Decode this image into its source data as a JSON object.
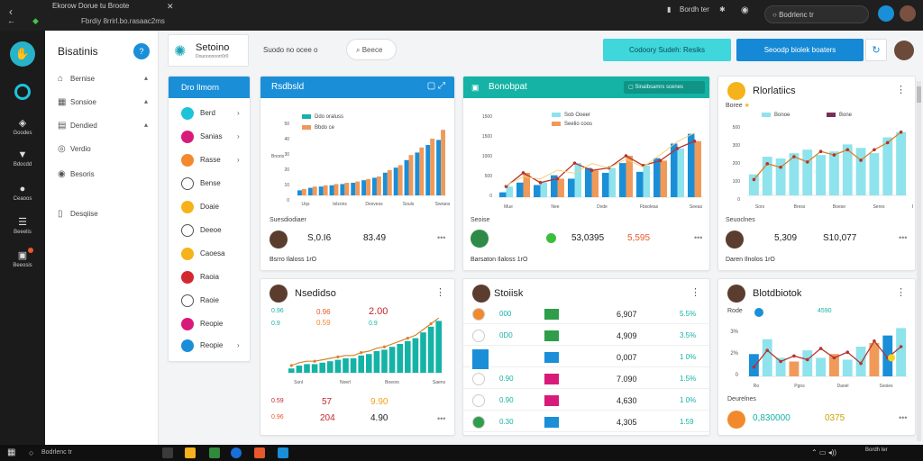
{
  "browser": {
    "tab_title": "Ekorow Dorue tu Broote",
    "url": "Fbrdiy 8rrirl.bo.rasaac2ms",
    "right_status": "Bordh ter",
    "search_text": "Bodrlenc tr"
  },
  "rail": {
    "items": [
      {
        "label": "Goodes"
      },
      {
        "label": "Bdocdd"
      },
      {
        "label": "Ceaoos"
      },
      {
        "label": "Beeelis"
      },
      {
        "label": "Beeosis"
      }
    ]
  },
  "sidebar": {
    "title": "Bisatinis",
    "items": [
      {
        "label": "Bernise",
        "icon": "home-icon"
      },
      {
        "label": "Sonsioe",
        "icon": "grid-icon"
      },
      {
        "label": "Dendied",
        "icon": "calendar-icon"
      },
      {
        "label": "Verdio",
        "icon": "clock-icon"
      },
      {
        "label": "Besoris",
        "icon": "globe-icon"
      },
      {
        "label": "Desqiise",
        "icon": "doc-icon"
      }
    ]
  },
  "header": {
    "logo_title": "Setoino",
    "logo_subtitle": "Dounoonoorr0r0",
    "select_label": "Suodo no ocee o",
    "search_label": "Beece",
    "btn_primary": "Codoory Sudeh: Resiks",
    "btn_secondary": "Seoodp biolek boaters"
  },
  "categories": {
    "title": "Dro Ilmorn",
    "items": [
      {
        "label": "Berd",
        "color": "#1ec3d9",
        "arrow": true
      },
      {
        "label": "Sanias",
        "color": "#d81b7a",
        "arrow": true
      },
      {
        "label": "Rasse",
        "color": "#f28a2d",
        "arrow": true
      },
      {
        "label": "Bense",
        "color": "#ffffff",
        "arrow": false
      },
      {
        "label": "Doaie",
        "color": "#f6b21b",
        "arrow": false
      },
      {
        "label": "Deeoe",
        "color": "#f6b21b",
        "arrow": false
      },
      {
        "label": "Caoesa",
        "color": "#d2282f",
        "arrow": false
      },
      {
        "label": "Raoia",
        "color": "#ffffff",
        "arrow": false
      },
      {
        "label": "Raoie",
        "color": "#d81b7a",
        "arrow": false
      },
      {
        "label": "Reopie",
        "color": "#1a8fd8",
        "arrow": true
      }
    ]
  },
  "card1": {
    "title": "Rsdbsld",
    "legend": [
      "Ddo oraluss",
      "Bbdo ce"
    ],
    "y_axis_label": "Bnoris",
    "foot_label": "Suesdiodiaer",
    "value_a": "S,0.I6",
    "value_b": "83.49",
    "note": "Bsrro Ilaloss  1rO"
  },
  "card2": {
    "title": "Bonobpat",
    "chip": "Sinaibsamrs scenes",
    "legend": [
      "Sob Ooeer",
      "Seelio coos"
    ],
    "foot_label": "Seoise",
    "value_a": "53,0395",
    "value_b": "5,595",
    "note": "Barsaton Ilaloss  1rO"
  },
  "card3": {
    "title": "Rlorlatiics",
    "legend": [
      "Boree",
      "Bonoe",
      "Bone"
    ],
    "foot_label": "Seuoclnes",
    "value_a": "5,309",
    "value_b": "S10,077",
    "note": "Daren Ilnolos  1rO"
  },
  "card4": {
    "title": "Nsedidso",
    "rows": [
      {
        "a": "0.96",
        "b": "2.00"
      },
      {
        "a": "0.9",
        "b": "0.59"
      }
    ],
    "foot": [
      {
        "a": "57",
        "b": "9.90"
      },
      {
        "a": "204",
        "b": "4.90"
      }
    ]
  },
  "card5": {
    "title": "Stoiisk",
    "rows": [
      {
        "name": "000",
        "value": "6,907",
        "pct": "5.5%"
      },
      {
        "name": "0D0",
        "value": "4,909",
        "pct": "3.5%"
      },
      {
        "name": "",
        "value": "0,007",
        "pct": "1 0%"
      },
      {
        "name": "0.90",
        "value": "7.090",
        "pct": "1.5%"
      },
      {
        "name": "0.90",
        "value": "4,630",
        "pct": "1 0%"
      },
      {
        "name": "0.30",
        "value": "4,305",
        "pct": "1.59"
      }
    ]
  },
  "card6": {
    "title": "Blotdbiotok",
    "legend": [
      "Rode",
      "4590"
    ],
    "foot_label": "Deurelnes",
    "value_a": "0,830000",
    "value_b": "0375"
  },
  "colors": {
    "blue": "#1a8fd8",
    "teal": "#14b3a6",
    "cyan": "#8ee3ec",
    "orange": "#f09a5a",
    "line_red": "#b5332d",
    "line_orange": "#d9822b"
  },
  "chart_data": [
    {
      "type": "bar",
      "title": "Rsdbsld",
      "categories": [
        "Uqs",
        "Ielzons",
        "Desvess",
        "Souls",
        "Swraos"
      ],
      "series": [
        {
          "name": "Ddo oraluss",
          "values": [
            4,
            6,
            7,
            8,
            9,
            10,
            12,
            14,
            18,
            22,
            28,
            34,
            40,
            44
          ]
        },
        {
          "name": "Bbdo ce",
          "values": [
            5,
            7,
            8,
            9,
            10,
            11,
            13,
            15,
            20,
            24,
            32,
            38,
            45,
            52
          ]
        }
      ],
      "y_ticks": [
        "50",
        "40",
        "30",
        "20",
        "10",
        "0"
      ]
    },
    {
      "type": "bar",
      "title": "Bonobpat",
      "categories": [
        "Mue",
        "Nee",
        "Dvde",
        "Fbsoleas",
        "Seeas"
      ],
      "y_ticks": [
        "1500",
        "1500",
        "1000",
        "500",
        "0"
      ],
      "series": [
        {
          "name": "Sob Ooeer",
          "values": [
            100,
            300,
            250,
            450,
            380,
            600,
            500,
            700,
            520,
            800,
            1100,
            1300
          ]
        },
        {
          "name": "Seelio coos",
          "values": [
            220,
            500,
            300,
            380,
            700,
            550,
            600,
            850,
            650,
            750,
            1000,
            1150
          ]
        }
      ]
    },
    {
      "type": "bar",
      "title": "Rlorlatiics",
      "categories": [
        "Sors",
        "Bress",
        "Boese",
        "Seres",
        "Bocos"
      ],
      "y_ticks": [
        "500",
        "300",
        "200",
        "100",
        "0"
      ],
      "series": [
        {
          "name": "Boree",
          "values": [
            120,
            220,
            210,
            240,
            260,
            230,
            250,
            290,
            270,
            240,
            330,
            360
          ]
        },
        {
          "name": "Bone",
          "values": [
            90,
            180,
            160,
            220,
            190,
            250,
            230,
            260,
            200,
            260,
            300,
            360
          ]
        }
      ]
    },
    {
      "type": "bar",
      "title": "Nsedidso",
      "categories": [
        "Ssnl",
        "Noerl",
        "Boeors",
        "Saens"
      ],
      "series": [
        {
          "name": "",
          "values": [
            3,
            5,
            6,
            6,
            7,
            8,
            9,
            10,
            10,
            12,
            13,
            15,
            16,
            18,
            20,
            22,
            24,
            28,
            32,
            36
          ]
        }
      ]
    },
    {
      "type": "bar",
      "title": "Blotdbiotok",
      "categories": [
        "Ro",
        "Pgos",
        "Daoel",
        "Ssoies"
      ],
      "y_ticks": [
        "3%",
        "2%",
        "0"
      ],
      "series": [
        {
          "name": "Rode",
          "values": [
            1.2,
            2.0,
            1.0,
            0.8,
            1.4,
            1.0,
            1.2,
            0.9,
            1.6,
            1.8,
            2.2,
            2.6
          ]
        },
        {
          "name": "4590",
          "values": [
            0.5,
            1.4,
            0.8,
            1.1,
            0.9,
            1.5,
            1.0,
            1.3,
            0.7,
            1.9,
            1.0,
            1.6
          ]
        }
      ]
    }
  ]
}
